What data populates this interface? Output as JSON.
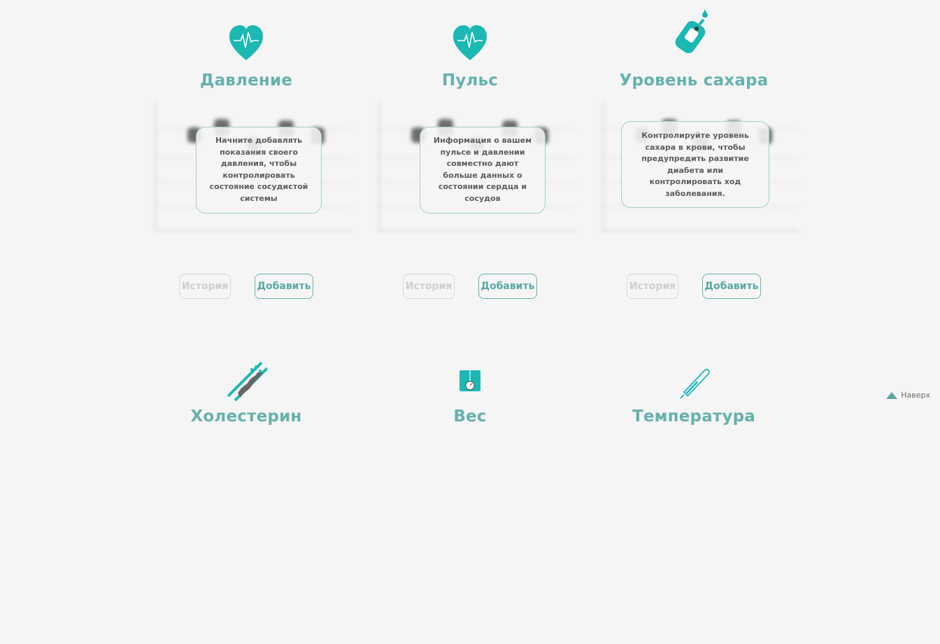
{
  "accent": "#66b1ae",
  "icon_color": "#1bb8b4",
  "cards": [
    {
      "title": "Давление",
      "icon": "heart-pulse-icon",
      "info": "Начните добавлять показания своего давления, чтобы контролировать состояние сосудистой системы",
      "history_label": "История",
      "add_label": "Добавить"
    },
    {
      "title": "Пульс",
      "icon": "heart-pulse-icon",
      "info": "Информация о вашем пульсе и давлении совместно дают больше данных о состоянии сердца и сосудов",
      "history_label": "История",
      "add_label": "Добавить"
    },
    {
      "title": "Уровень сахара",
      "icon": "glucometer-icon",
      "info": "Контролируйте уровень сахара в крови, чтобы предупредить развитие диабета или контролировать ход заболевания.",
      "history_label": "История",
      "add_label": "Добавить"
    }
  ],
  "lower_cards": [
    {
      "title": "Холестерин",
      "icon": "artery-icon"
    },
    {
      "title": "Вес",
      "icon": "scale-icon"
    },
    {
      "title": "Температура",
      "icon": "thermometer-icon"
    }
  ],
  "to_top_label": "Наверх"
}
